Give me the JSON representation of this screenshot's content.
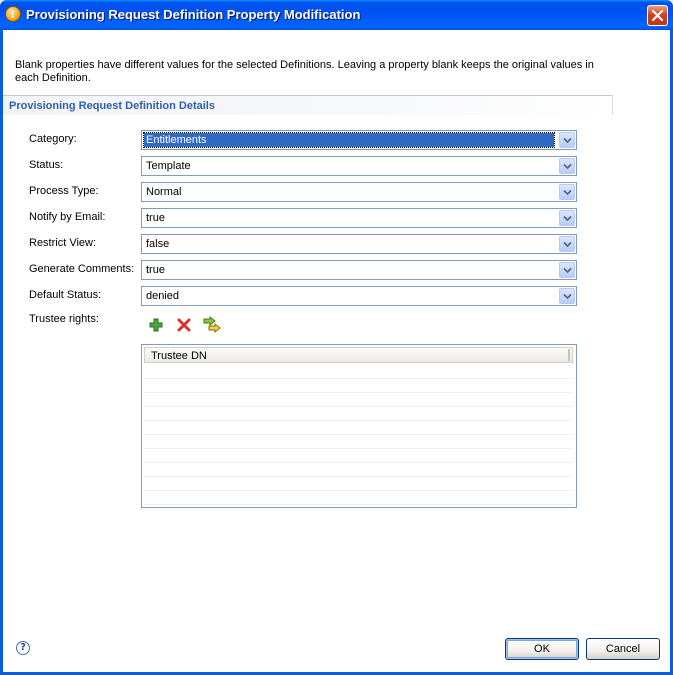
{
  "window": {
    "title": "Provisioning Request Definition Property Modification"
  },
  "banner": {
    "message": "Blank properties have different values for the selected Definitions.  Leaving a property blank keeps the original values in each Definition."
  },
  "section": {
    "title": "Provisioning Request Definition Details"
  },
  "fields": {
    "category": {
      "label": "Category:",
      "value": "Entitlements"
    },
    "status": {
      "label": "Status:",
      "value": "Template"
    },
    "process_type": {
      "label": "Process Type:",
      "value": "Normal"
    },
    "notify_by_email": {
      "label": "Notify by Email:",
      "value": "true"
    },
    "restrict_view": {
      "label": "Restrict View:",
      "value": "false"
    },
    "generate_comments": {
      "label": "Generate Comments:",
      "value": "true"
    },
    "default_status": {
      "label": "Default Status:",
      "value": "denied"
    }
  },
  "trustee": {
    "label": "Trustee rights:",
    "columns": [
      "Trustee DN"
    ],
    "rows": []
  },
  "buttons": {
    "ok": "OK",
    "cancel": "Cancel",
    "help": "?"
  },
  "icons": {
    "add": "plus-icon",
    "remove": "delete-x-icon",
    "edit": "edit-trustee-icon",
    "help": "help-icon",
    "close": "close-icon"
  },
  "colors": {
    "title_bar": "#0053EE",
    "section_title": "#315EAA",
    "selection": "#316AC5"
  }
}
